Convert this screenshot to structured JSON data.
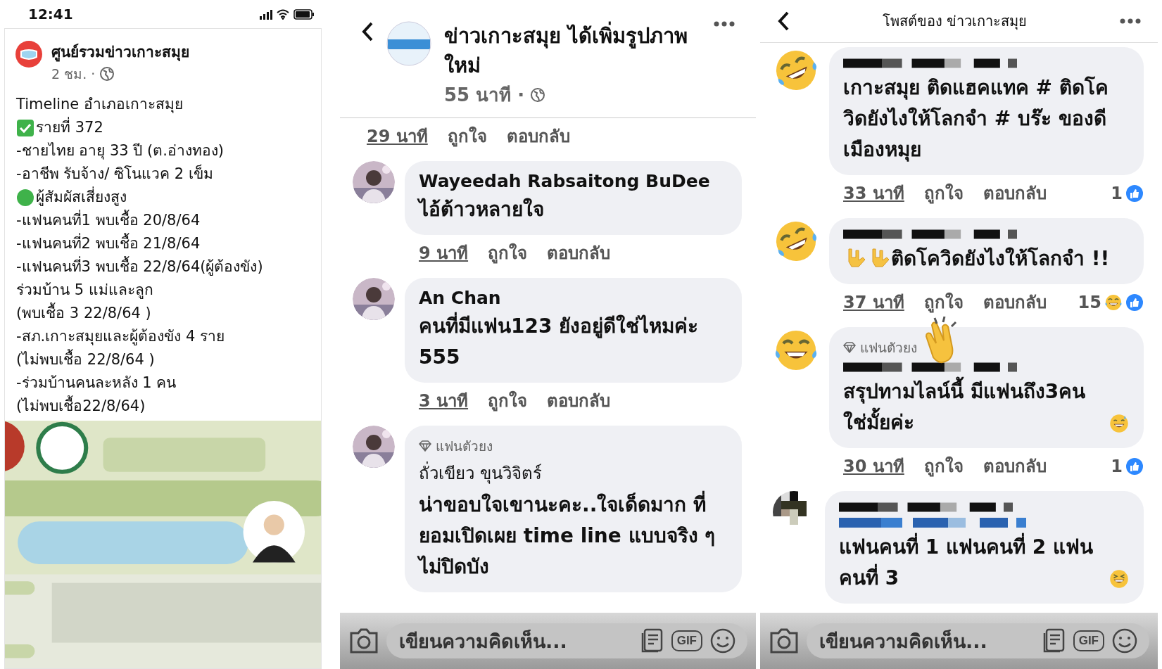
{
  "panels": [
    {
      "kind": "post",
      "status_bar": {
        "time": "12:41"
      },
      "post": {
        "author": "ศูนย์รวมข่าวเกาะสมุย",
        "time": "2 ชม. ·",
        "lines": [
          {
            "text": "Timeline อำเภอเกาะสมุย"
          },
          {
            "text": "รายที่ 372",
            "kind": "check"
          },
          {
            "text": "-ชายไทย อายุ 33 ปี (ต.อ่างทอง)"
          },
          {
            "text": "-อาชีพ รับจ้าง/ ซิโนแวค 2 เข็ม"
          },
          {
            "text": "ผู้สัมผัสเสี่ยงสูง",
            "kind": "dot"
          },
          {
            "text": "-แฟนคนที่1 พบเชื้อ 20/8/64"
          },
          {
            "text": "-แฟนคนที่2 พบเชื้อ 21/8/64"
          },
          {
            "text": "-แฟนคนที่3 พบเชื้อ 22/8/64(ผู้ต้องขัง)"
          },
          {
            "text": "ร่วมบ้าน 5 แม่และลูก"
          },
          {
            "text": "(พบเชื้อ 3 22/8/64 )"
          },
          {
            "text": "-สภ.เกาะสมุยและผู้ต้องขัง 4 ราย"
          },
          {
            "text": "(ไม่พบเชื้อ 22/8/64 )"
          },
          {
            "text": "-ร่วมบ้านคนละหลัง 1 คน"
          },
          {
            "text": "(ไม่พบเชื้อ22/8/64)"
          }
        ]
      }
    },
    {
      "kind": "comments",
      "header": {
        "title": "ข่าวเกาะสมุย ได้เพิ่มรูปภาพใหม่",
        "subtitle": "55 นาที ·"
      },
      "top_actions": {
        "time": "29 นาที",
        "like": "ถูกใจ",
        "reply": "ตอบกลับ"
      },
      "comments": [
        {
          "name": "Wayeedah Rabsaitong BuDee",
          "name_bold": true,
          "body": "ไอ้ต้าวหลายใจ",
          "actions": {
            "time": "9 นาที",
            "like": "ถูกใจ",
            "reply": "ตอบกลับ"
          }
        },
        {
          "name": "An Chan",
          "name_bold": true,
          "body": "คนที่มีแฟน123 ยังอยู่ดีใช่ไหมค่ะ 555",
          "actions": {
            "time": "3 นาที",
            "like": "ถูกใจ",
            "reply": "ตอบกลับ"
          }
        },
        {
          "badge": "แฟนตัวยง",
          "name": "ถั่วเขียว ขุนวิจิตร์",
          "name_bold": false,
          "body": "น่าขอบใจเขานะคะ..ใจเด็ดมาก ที่ยอมเปิดเผย time line แบบจริง ๆ ไม่ปิดบัง"
        }
      ],
      "composer": {
        "placeholder": "เขียนความคิดเห็น...",
        "gif": "GIF"
      }
    },
    {
      "kind": "comments",
      "header": {
        "centered_title": "โพสต์ของ ข่าวเกาะสมุย"
      },
      "comments": [
        {
          "avatar": {
            "kind": "rofl"
          },
          "name_redacted": true,
          "body": "เกาะสมุย ติดแฮคแทค # ติดโควิดยังไงให้โลกจำ # บร๊ะ ของดีเมืองหมุย",
          "actions": {
            "time": "33 นาที",
            "like": "ถูกใจ",
            "reply": "ตอบกลับ",
            "count": "1",
            "reaction": {
              "kind": "like"
            }
          }
        },
        {
          "avatar": {
            "kind": "rofl"
          },
          "name_redacted": true,
          "emoji": {
            "kind": "hands"
          },
          "body": "ติดโควิดยังไงให้โลกจำ !!",
          "actions": {
            "time": "37 นาที",
            "like": "ถูกใจ",
            "reply": "ตอบกลับ",
            "count": "15",
            "reaction": {
              "kind": "haha-like"
            }
          }
        },
        {
          "avatar": {
            "kind": "joy"
          },
          "badge": "แฟนตัวยง",
          "name_redacted": true,
          "emoji": {
            "kind": "sweat"
          },
          "body": "สรุปทามไลน์นี้ มีแฟนถึง3คนใช่มั้ยค่ะ",
          "actions": {
            "time": "30 นาที",
            "like": "ถูกใจ",
            "reply": "ตอบกลับ",
            "count": "1",
            "reaction": {
              "kind": "like"
            }
          }
        },
        {
          "avatar": {
            "kind": "pixel"
          },
          "name_redacted": true,
          "emoji": {
            "kind": "squint"
          },
          "lead_redacted": true,
          "body": "แฟนคนที่ 1 แฟนคนที่ 2 แฟนคนที่ 3"
        }
      ],
      "composer": {
        "placeholder": "เขียนความคิดเห็น...",
        "gif": "GIF"
      }
    }
  ]
}
